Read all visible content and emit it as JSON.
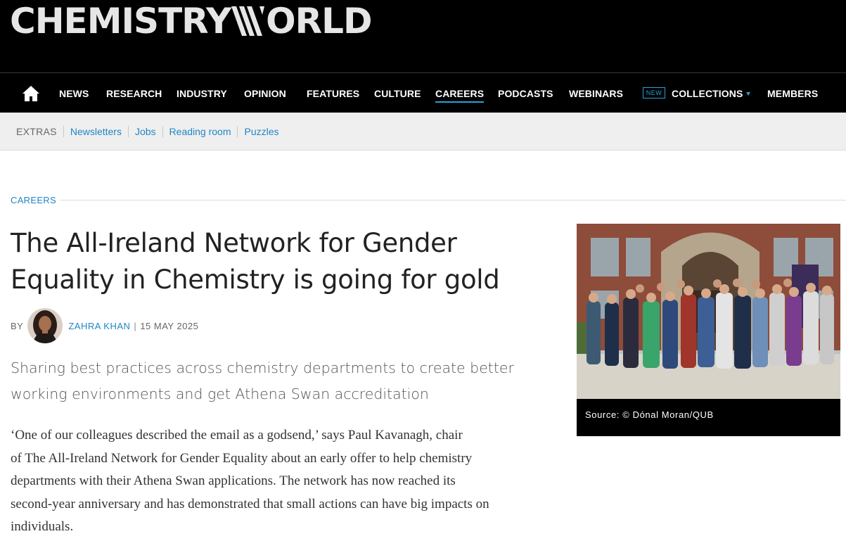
{
  "logo": {
    "part1": "CHEMISTRY",
    "part2": "ORLD",
    "alt": "Chemistry World"
  },
  "nav": {
    "home_icon": "home-icon",
    "items": [
      "NEWS",
      "RESEARCH",
      "INDUSTRY",
      "OPINION",
      "FEATURES",
      "CULTURE",
      "CAREERS",
      "PODCASTS",
      "WEBINARS",
      "COLLECTIONS",
      "MEMBERS"
    ],
    "active": "CAREERS",
    "new_badge": "NEW"
  },
  "subnav": {
    "label": "EXTRAS",
    "links": [
      "Newsletters",
      "Jobs",
      "Reading room",
      "Puzzles"
    ]
  },
  "article": {
    "section": "CAREERS",
    "headline_line1": "The All-Ireland Network for Gender",
    "headline_line2": "Equality in Chemistry is going for gold",
    "by": "BY",
    "author": "ZAHRA KHAN",
    "separator": "|",
    "date": "15 MAY 2025",
    "standfirst_line1": "Sharing best practices across chemistry departments to create better",
    "standfirst_line2": "working environments and get Athena Swan accreditation",
    "body_line1": "‘One of our colleagues described the email as a godsend,’ says Paul Kavanagh, chair",
    "body_line2": "of The All-Ireland Network for Gender Equality about an early offer to help chemistry",
    "body_line3": "departments with their Athena Swan applications. The network has now reached its",
    "body_line4": "second-year anniversary and has demonstrated that small actions can have big impacts on",
    "body_line5": "individuals.",
    "image_caption": "Source: © Dónal Moran/QUB"
  },
  "colors": {
    "accent": "#1f86c4",
    "header_bg": "#000000",
    "subnav_bg": "#efefef"
  }
}
